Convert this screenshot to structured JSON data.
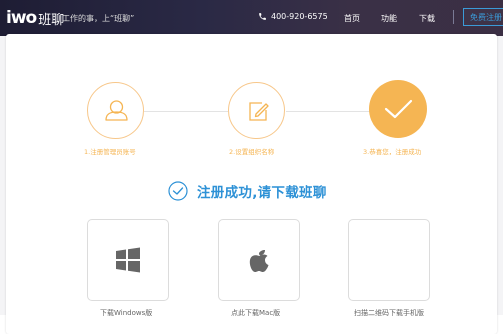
{
  "header": {
    "logo_mark": "iwo",
    "logo_cn": "班聊",
    "slogan": "工作的事，上“班聊”",
    "phone": "400-920-6575",
    "nav": [
      "首页",
      "功能",
      "下载"
    ],
    "free_button": "免费注册"
  },
  "steps": [
    {
      "label": "1.注册管理员账号",
      "icon": "user-icon",
      "state": "done"
    },
    {
      "label": "2.设置组织名称",
      "icon": "edit-icon",
      "state": "done"
    },
    {
      "label": "3.恭喜您，注册成功",
      "icon": "check-icon",
      "state": "current"
    }
  ],
  "success_message": "注册成功,请下载班聊",
  "downloads": [
    {
      "label": "下载Windows版",
      "icon": "windows-icon"
    },
    {
      "label": "点此下载Mac版",
      "icon": "apple-icon"
    },
    {
      "label": "扫描二维码下载手机版",
      "icon": "qr-code"
    }
  ],
  "colors": {
    "accent_orange": "#f5b553",
    "accent_blue": "#2d91d6",
    "header_bg": "#2a2945"
  }
}
